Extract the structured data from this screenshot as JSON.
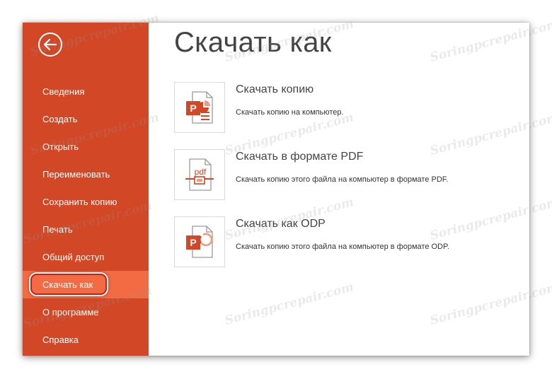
{
  "sidebar": {
    "back_icon": "back-arrow-icon",
    "items": [
      {
        "label": "Сведения",
        "active": false
      },
      {
        "label": "Создать",
        "active": false
      },
      {
        "label": "Открыть",
        "active": false
      },
      {
        "label": "Переименовать",
        "active": false
      },
      {
        "label": "Сохранить копию",
        "active": false
      },
      {
        "label": "Печать",
        "active": false
      },
      {
        "label": "Общий доступ",
        "active": false
      },
      {
        "label": "Скачать как",
        "active": true
      },
      {
        "label": "О программе",
        "active": false
      },
      {
        "label": "Справка",
        "active": false
      }
    ]
  },
  "main": {
    "title": "Скачать как",
    "options": [
      {
        "title": "Скачать копию",
        "description": "Скачать копию на компьютер.",
        "icon": "powerpoint-file-icon"
      },
      {
        "title": "Скачать в формате PDF",
        "description": "Скачать копию этого файла на компьютер в формате PDF.",
        "icon": "pdf-file-icon",
        "icon_text": "pdf"
      },
      {
        "title": "Скачать как ODP",
        "description": "Скачать копию этого файла на компьютер в формате ODP.",
        "icon": "odp-file-icon"
      }
    ]
  },
  "watermark": "Soringpcrepair.com",
  "colors": {
    "sidebar_bg": "#d24726",
    "active_item_bg": "#f26b43",
    "highlight_border": "#c2201b",
    "powerpoint_red": "#d24726"
  }
}
